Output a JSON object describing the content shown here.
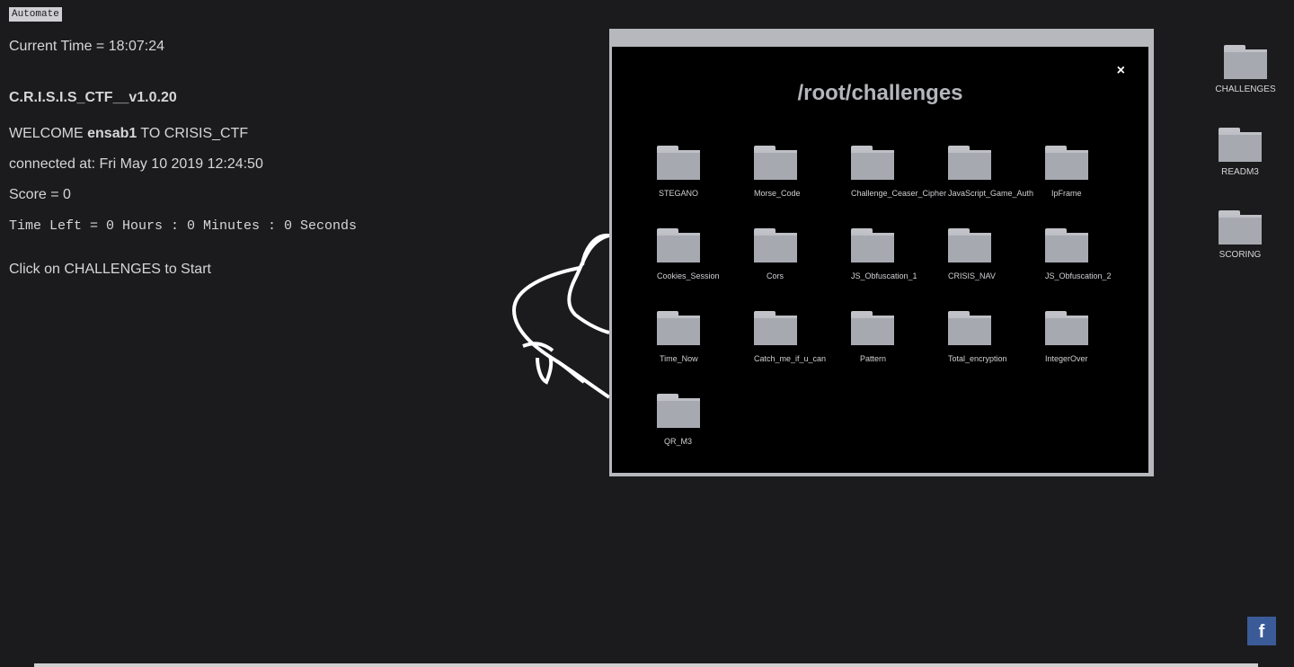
{
  "automate_label": "Automate",
  "info": {
    "current_time": "Current Time = 18:07:24",
    "version": "C.R.I.S.I.S_CTF__v1.0.20",
    "welcome_prefix": "WELCOME ",
    "username": "ensab1",
    "welcome_suffix": " TO CRISIS_CTF",
    "connected": "connected at: Fri May 10 2019 12:24:50",
    "score": "Score = 0",
    "time_left": "Time Left = 0 Hours : 0 Minutes : 0 Seconds",
    "hint": "Click on CHALLENGES to Start"
  },
  "desktop": {
    "icons": [
      {
        "label": "CHALLENGES",
        "icon": "folder-icon"
      },
      {
        "label": "READM3",
        "icon": "folder-icon"
      },
      {
        "label": "SCORING",
        "icon": "folder-icon"
      }
    ]
  },
  "window": {
    "title": "/root/challenges",
    "close": "×",
    "folders": [
      "STEGANO",
      "Morse_Code",
      "Challenge_Ceaser_Cipher",
      "JavaScript_Game_Auth",
      "IpFrame",
      "Cookies_Session",
      "Cors",
      "JS_Obfuscation_1",
      "CRISIS_NAV",
      "JS_Obfuscation_2",
      "Time_Now",
      "Catch_me_if_u_can",
      "Pattern",
      "Total_encryption",
      "IntegerOver",
      "QR_M3"
    ]
  },
  "facebook": "f",
  "colors": {
    "background": "#1b1b1d",
    "folder": "#a7a9b1",
    "window_frame": "#b7b8bd",
    "facebook": "#3b5b98"
  }
}
